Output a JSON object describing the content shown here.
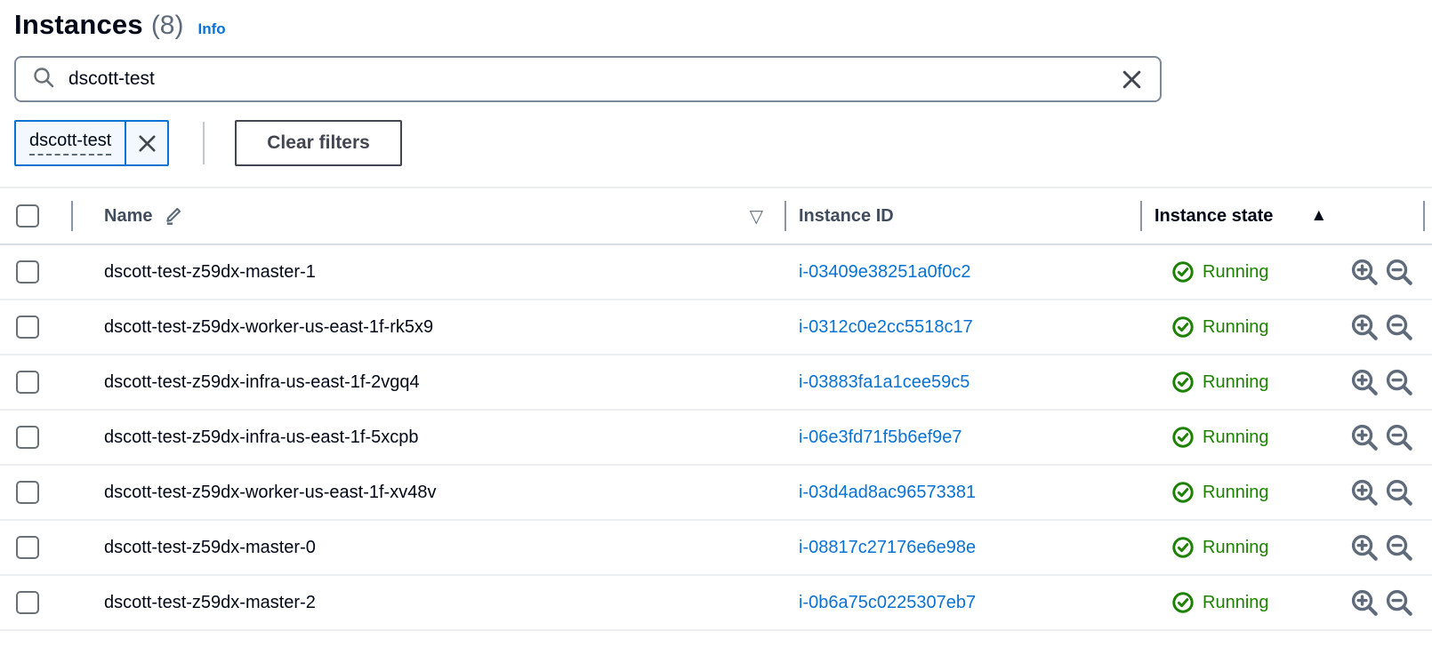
{
  "header": {
    "title": "Instances",
    "count": "(8)",
    "info_label": "Info"
  },
  "search": {
    "value": "dscott-test",
    "placeholder": ""
  },
  "filters": {
    "chip_label": "dscott-test",
    "clear_label": "Clear filters"
  },
  "glyphs": {
    "sort_inactive": "▽",
    "sort_active": "▲"
  },
  "colors": {
    "accent_blue": "#0972d3",
    "success_green": "#1d8102",
    "header_gray": "#414d5c",
    "icon_gray": "#5f6b7a"
  },
  "table": {
    "columns": {
      "name": "Name",
      "instance_id": "Instance ID",
      "instance_state": "Instance state"
    },
    "rows": [
      {
        "name": "dscott-test-z59dx-master-1",
        "id": "i-03409e38251a0f0c2",
        "state": "Running"
      },
      {
        "name": "dscott-test-z59dx-worker-us-east-1f-rk5x9",
        "id": "i-0312c0e2cc5518c17",
        "state": "Running"
      },
      {
        "name": "dscott-test-z59dx-infra-us-east-1f-2vgq4",
        "id": "i-03883fa1a1cee59c5",
        "state": "Running"
      },
      {
        "name": "dscott-test-z59dx-infra-us-east-1f-5xcpb",
        "id": "i-06e3fd71f5b6ef9e7",
        "state": "Running"
      },
      {
        "name": "dscott-test-z59dx-worker-us-east-1f-xv48v",
        "id": "i-03d4ad8ac96573381",
        "state": "Running"
      },
      {
        "name": "dscott-test-z59dx-master-0",
        "id": "i-08817c27176e6e98e",
        "state": "Running"
      },
      {
        "name": "dscott-test-z59dx-master-2",
        "id": "i-0b6a75c0225307eb7",
        "state": "Running"
      }
    ]
  }
}
